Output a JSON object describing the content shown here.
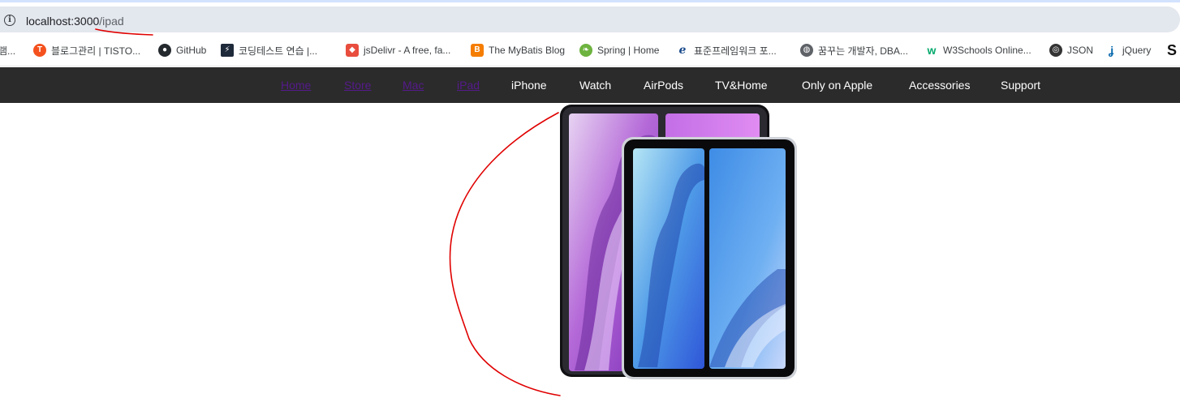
{
  "browser": {
    "url_host": "localhost:3000",
    "url_path": "/ipad"
  },
  "bookmarks": [
    {
      "label": "램...",
      "icon": "folder-icon",
      "color": "#9aa0a6"
    },
    {
      "label": "블로그관리 | TISTO...",
      "icon": "tistory-icon",
      "color": "#f4511e"
    },
    {
      "label": "GitHub",
      "icon": "github-icon",
      "color": "#24292e"
    },
    {
      "label": "코딩테스트 연습 |...",
      "icon": "programmers-icon",
      "color": "#1e2a3a"
    },
    {
      "label": "jsDelivr - A free, fa...",
      "icon": "jsdelivr-icon",
      "color": "#e84d3d"
    },
    {
      "label": "The MyBatis Blog",
      "icon": "blogger-icon",
      "color": "#f57d00"
    },
    {
      "label": "Spring | Home",
      "icon": "spring-icon",
      "color": "#6db33f"
    },
    {
      "label": "표준프레임워크 포...",
      "icon": "egov-icon",
      "color": "#1a4a8c"
    },
    {
      "label": "꿈꾸는 개발자, DBA...",
      "icon": "globe-icon",
      "color": "#5f6368"
    },
    {
      "label": "W3Schools Online...",
      "icon": "w3schools-icon",
      "color": "#04aa6d"
    },
    {
      "label": "JSON",
      "icon": "json-icon",
      "color": "#333333"
    },
    {
      "label": "jQuery",
      "icon": "jquery-icon",
      "color": "#0769ad"
    }
  ],
  "nav": {
    "items": [
      "Home",
      "Store",
      "Mac",
      "iPad",
      "iPhone",
      "Watch",
      "AirPods",
      "TV&Home",
      "Only on Apple",
      "Accessories",
      "Support"
    ]
  },
  "colors": {
    "nav_bg": "#2b2b2b",
    "visited_link": "#551a8b",
    "annotation": "#e00000"
  }
}
